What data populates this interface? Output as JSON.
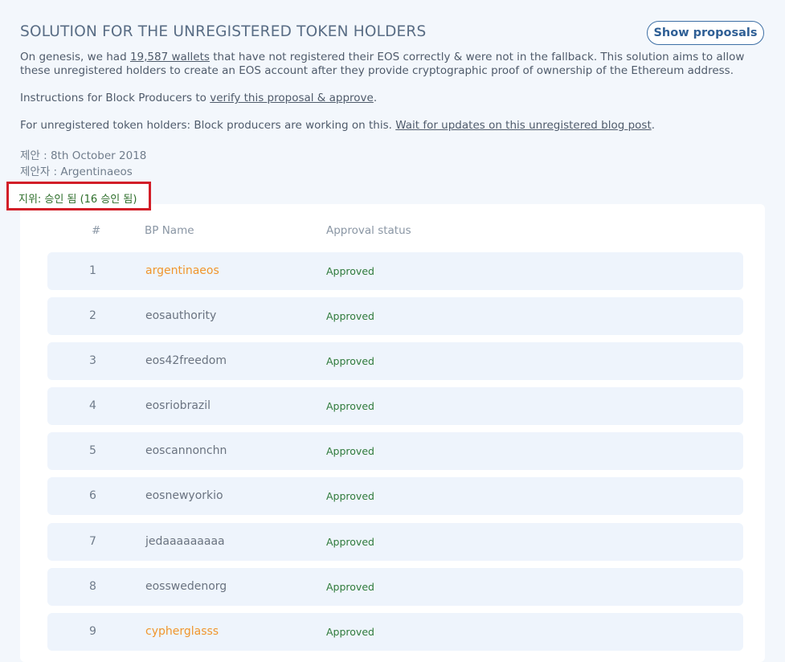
{
  "title": "SOLUTION FOR THE UNREGISTERED TOKEN HOLDERS",
  "show_proposals_label": "Show proposals",
  "para1": {
    "pre": "On genesis, we had ",
    "link": "19,587 wallets",
    "post": " that have not registered their EOS correctly & were not in the fallback. This solution aims to allow these unregistered holders to create an EOS account after they provide cryptographic proof of ownership of the Ethereum address."
  },
  "para2": {
    "pre": "Instructions for Block Producers to ",
    "link": "verify this proposal & approve",
    "post": "."
  },
  "para3": {
    "pre": "For unregistered token holders: Block producers are working on this. ",
    "link": "Wait for updates on this unregistered blog post",
    "post": "."
  },
  "proposal_date": "제안 : 8th October 2018",
  "proposer": "제안자 : Argentinaeos",
  "status": "지위: 승인 됨 (16 승인 됨)",
  "table": {
    "headers": {
      "num": "#",
      "name": "BP Name",
      "status": "Approval status"
    },
    "rows": [
      {
        "num": "1",
        "name": "argentinaeos",
        "status": "Approved",
        "highlight": true
      },
      {
        "num": "2",
        "name": "eosauthority",
        "status": "Approved",
        "highlight": false
      },
      {
        "num": "3",
        "name": "eos42freedom",
        "status": "Approved",
        "highlight": false
      },
      {
        "num": "4",
        "name": "eosriobrazil",
        "status": "Approved",
        "highlight": false
      },
      {
        "num": "5",
        "name": "eoscannonchn",
        "status": "Approved",
        "highlight": false
      },
      {
        "num": "6",
        "name": "eosnewyorkio",
        "status": "Approved",
        "highlight": false
      },
      {
        "num": "7",
        "name": "jedaaaaaaaaa",
        "status": "Approved",
        "highlight": false
      },
      {
        "num": "8",
        "name": "eosswedenorg",
        "status": "Approved",
        "highlight": false
      },
      {
        "num": "9",
        "name": "cypherglasss",
        "status": "Approved",
        "highlight": true
      }
    ]
  },
  "colors": {
    "highlight_name": "#f0962d",
    "approved": "#2e7a3a",
    "status_box_border": "#d21e28",
    "button_border": "#3d6fa5"
  }
}
